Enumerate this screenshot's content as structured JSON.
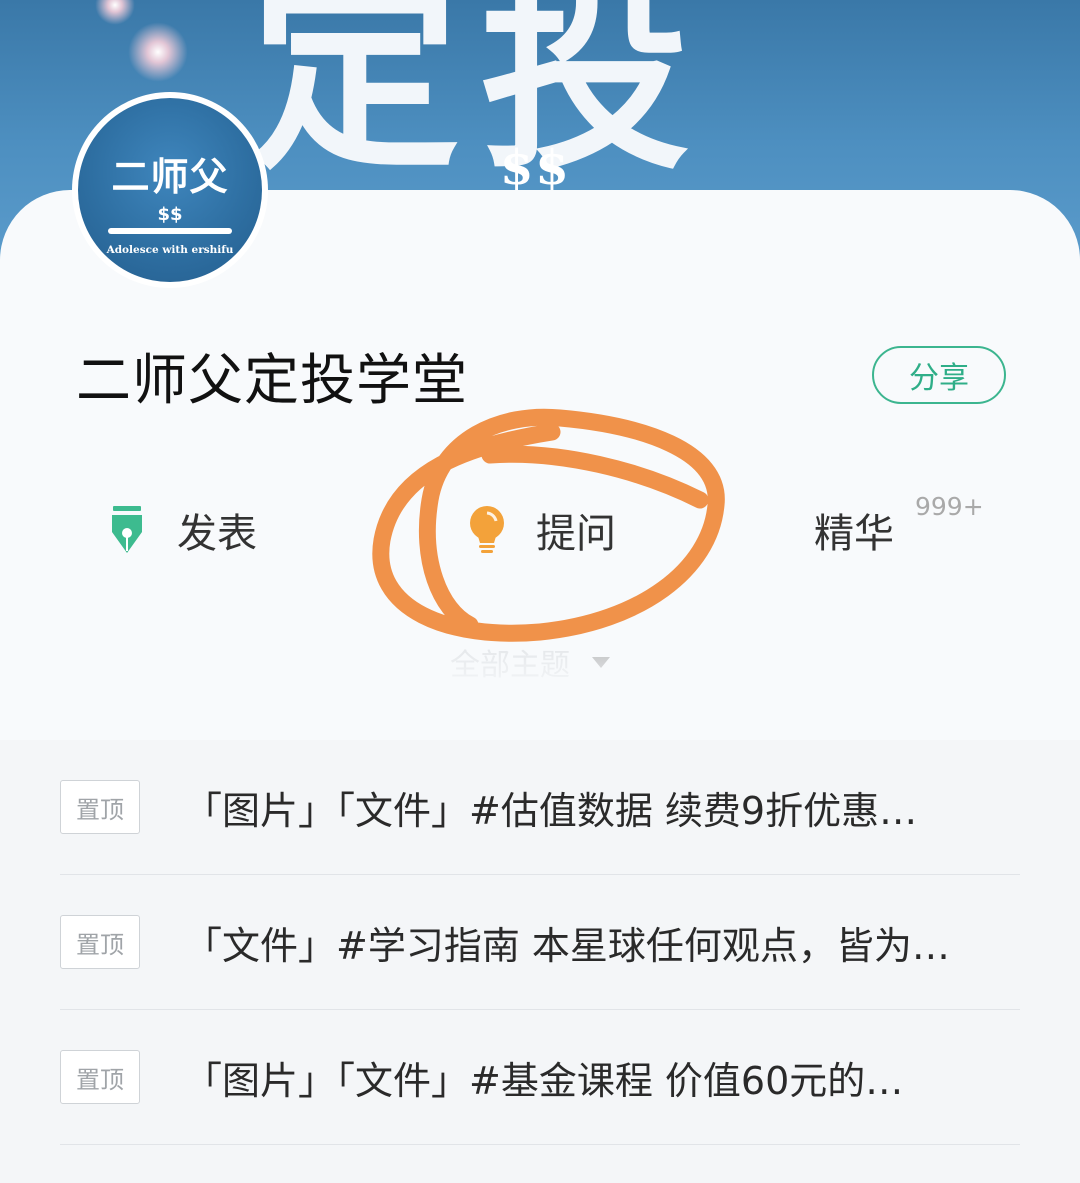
{
  "banner": {
    "text": "定投",
    "dollars": "$$"
  },
  "avatar": {
    "title": "二师父",
    "dollars": "$$",
    "caption": "Adolesce with ershifu"
  },
  "group": {
    "title": "二师父定投学堂",
    "share_label": "分享"
  },
  "actions": {
    "post_label": "发表",
    "ask_label": "提问",
    "featured_label": "精华",
    "featured_count": "999+"
  },
  "filter": {
    "label": "全部主题"
  },
  "feed": [
    {
      "badge": "置顶",
      "text": "「图片」「文件」#估值数据  续费9折优惠…"
    },
    {
      "badge": "置顶",
      "text": "「文件」#学习指南  本星球任何观点，皆为…"
    },
    {
      "badge": "置顶",
      "text": "「图片」「文件」#基金课程   价值60元的…"
    }
  ],
  "colors": {
    "accent_green": "#2fae88",
    "lightbulb": "#f3a23a",
    "annotation": "#f0924a"
  },
  "icons": [
    "pen-nib-icon",
    "lightbulb-icon",
    "dropdown-arrow-icon"
  ]
}
